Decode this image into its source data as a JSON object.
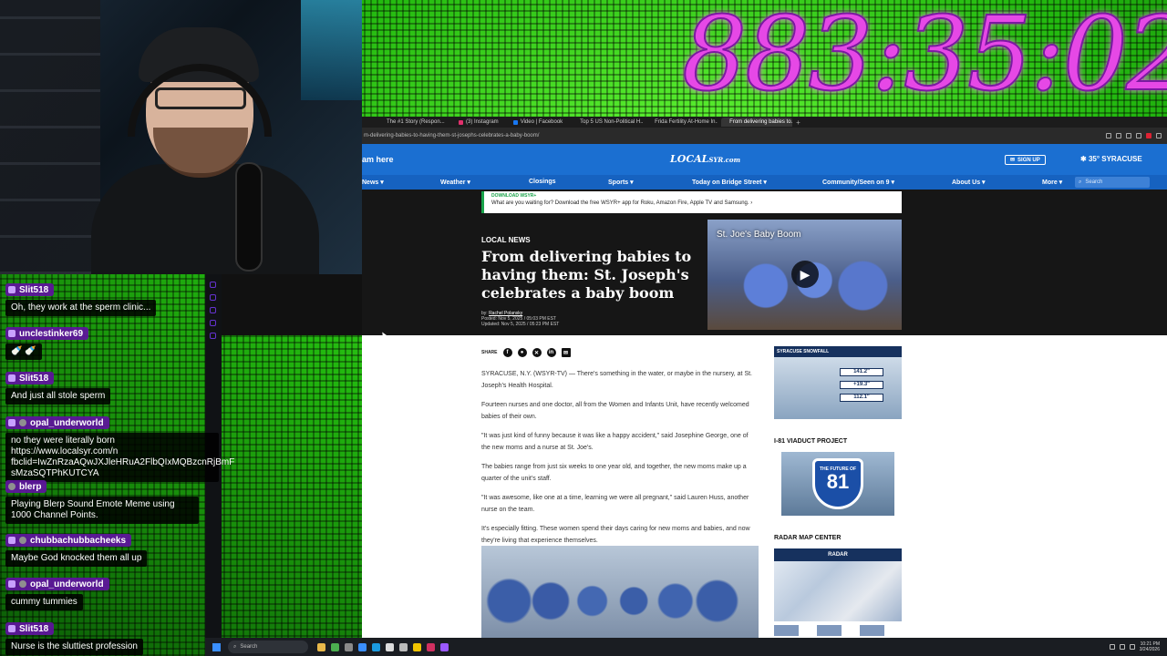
{
  "overlay": {
    "timer": "883:35:02"
  },
  "browser": {
    "tabs": [
      {
        "label": "The #1 Story (Respon...",
        "color": "#4caf50",
        "active": false
      },
      {
        "label": "(3) Instagram",
        "color": "#e1306c",
        "active": false
      },
      {
        "label": "Video | Facebook",
        "color": "#1877f2",
        "active": false
      },
      {
        "label": "Top 5 US Non-Political H...",
        "color": "#888888",
        "active": false
      },
      {
        "label": "Frida Fertility At-Home In...",
        "color": "#e53935",
        "active": false
      },
      {
        "label": "From delivering babies to...",
        "color": "#1b6fd1",
        "active": true
      }
    ],
    "url": "m-delivering-babies-to-having-them-st-josephs-celebrates-a-baby-boom/"
  },
  "site": {
    "promo_left": "am here",
    "logo": "LOCAL",
    "logo_small": "SYR.com",
    "signup": "SIGN UP",
    "weather": "35°  SYRACUSE",
    "nav": [
      "News ▾",
      "Weather ▾",
      "Closings",
      "Sports ▾",
      "Today on Bridge Street ▾",
      "Community/Seen on 9 ▾",
      "About Us ▾",
      "More ▾"
    ],
    "search_placeholder": "Search"
  },
  "article": {
    "promo_kicker": "DOWNLOAD WSYR+",
    "promo_text": "What are you waiting for? Download the free WSYR+ app for Roku, Amazon Fire, Apple TV and Samsung. ›",
    "kicker": "LOCAL NEWS",
    "headline": "From delivering babies to having them: St. Joseph's celebrates a baby boom",
    "byline_prefix": "by:",
    "author": "Rachel Polansky",
    "posted": "Posted: Nov 5, 2025 / 05:03 PM EST",
    "updated": "Updated: Nov 5, 2025 / 05:23 PM EST",
    "video_title": "St. Joe's Baby Boom",
    "share_label": "SHARE",
    "paragraphs": [
      "SYRACUSE, N.Y. (WSYR-TV) — There's something in the water, or maybe in the nursery, at St. Joseph's Health Hospital.",
      "Fourteen nurses and one doctor, all from the Women and Infants Unit, have recently welcomed babies of their own.",
      "\"It was just kind of funny because it was like a happy accident,\" said Josephine George, one of the new moms and a nurse at St. Joe's.",
      "The babies range from just six weeks to one year old, and together, the new moms make up a quarter of the unit's staff.",
      "\"It was awesome, like one at a time, learning we were all pregnant,\" said Lauren Huss, another nurse on the team.",
      "It's especially fitting. These women spend their days caring for new moms and babies, and now they're living that experience themselves."
    ]
  },
  "sidebar": {
    "ad_title": "SYRACUSE SNOWFALL",
    "ad_values": [
      "141.2\"",
      "+19.3\"",
      "112.1\""
    ],
    "i81_heading": "I-81 VIADUCT PROJECT",
    "i81_tagline": "THE FUTURE OF",
    "i81_number": "81",
    "radar_heading": "RADAR MAP CENTER",
    "radar_label": "RADAR"
  },
  "chat": [
    {
      "user": "Slit518",
      "text": "Oh, they work at the sperm clinic..."
    },
    {
      "user": "unclestinker69",
      "text": "🍼 🍼"
    },
    {
      "user": "Slit518",
      "text": "And just all stole sperm"
    },
    {
      "user": "opal_underworld",
      "text": "no they were literally born https://www.localsyr.com/n fbclid=IwZnRzaAQwJXJleHRuA2FlbQIxMQBzcnRjBmF sMzaSQTPhKUTCYA"
    },
    {
      "user": "blerp",
      "text": "Playing Blerp Sound Emote Meme using 1000 Channel Points."
    },
    {
      "user": "chubbachubbacheeks",
      "text": "Maybe God knocked them all up"
    },
    {
      "user": "opal_underworld",
      "text": "cummy tummies"
    },
    {
      "user": "Slit518",
      "text": "Nurse is the sluttiest profession"
    }
  ],
  "taskbar": {
    "search": "Search",
    "time": "10:21 PM",
    "date": "3/24/2026"
  },
  "colors": {
    "brand_blue": "#1b6fd1",
    "timer": "#e648e6",
    "chat_name_bg": "#5f14a0"
  }
}
